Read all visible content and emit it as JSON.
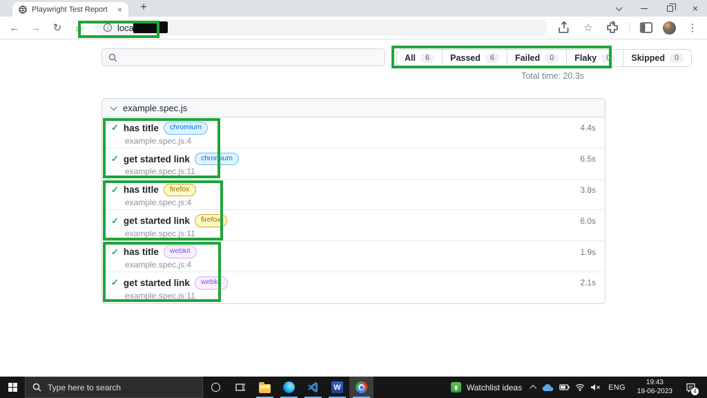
{
  "browser": {
    "tab_title": "Playwright Test Report",
    "tab_close": "×",
    "new_tab": "+",
    "url_text": "localhost:",
    "back": "←",
    "forward": "→",
    "reload": "↻",
    "home": "⌂",
    "bookmark_star": "☆",
    "menu_kebab": "⋮",
    "window_controls": [
      "tab-search-chevron",
      "minimize",
      "restore",
      "close"
    ],
    "toolbar_icons": [
      "back",
      "forward",
      "reload",
      "home",
      "site-info",
      "share",
      "bookmark-star",
      "extensions",
      "side-panel",
      "profile-avatar",
      "menu-kebab"
    ]
  },
  "report": {
    "search": {
      "value": "",
      "placeholder": ""
    },
    "filters": [
      {
        "label": "All",
        "count": "6"
      },
      {
        "label": "Passed",
        "count": "6"
      },
      {
        "label": "Failed",
        "count": "0"
      },
      {
        "label": "Flaky",
        "count": "0"
      },
      {
        "label": "Skipped",
        "count": "0"
      }
    ],
    "total_time": "Total time: 20.3s",
    "file_group": {
      "name": "example.spec.js",
      "tests": [
        {
          "title": "has title",
          "browser": "chromium",
          "location": "example.spec.js:4",
          "duration": "4.4s"
        },
        {
          "title": "get started link",
          "browser": "chromium",
          "location": "example.spec.js:11",
          "duration": "6.5s"
        },
        {
          "title": "has title",
          "browser": "firefox",
          "location": "example.spec.js:4",
          "duration": "3.8s"
        },
        {
          "title": "get started link",
          "browser": "firefox",
          "location": "example.spec.js:11",
          "duration": "6.0s"
        },
        {
          "title": "has title",
          "browser": "webkit",
          "location": "example.spec.js:4",
          "duration": "1.9s"
        },
        {
          "title": "get started link",
          "browser": "webkit",
          "location": "example.spec.js:11",
          "duration": "2.1s"
        }
      ]
    },
    "check_glyph": "✓",
    "badge_colors": {
      "chromium": {
        "bg": "#ddf4ff",
        "border": "#6cb6ff",
        "text": "#0969da"
      },
      "firefox": {
        "bg": "#fff8c5",
        "border": "#d4a72c",
        "text": "#9a6700"
      },
      "webkit": {
        "bg": "#fbefff",
        "border": "#d2a8ff",
        "text": "#8250df"
      }
    }
  },
  "annotations": {
    "color": "#1ea53b",
    "regions": [
      "url-bar",
      "filter-tabs",
      "chromium-tests",
      "firefox-tests",
      "webkit-tests"
    ]
  },
  "taskbar": {
    "search_placeholder": "Type here to search",
    "pinned_label": "Watchlist ideas",
    "language": "ENG",
    "time": "19:43",
    "date": "19-06-2023",
    "notification_count": "4",
    "app_icons": [
      "start",
      "cortana",
      "task-view",
      "file-explorer",
      "edge",
      "vscode",
      "word",
      "chrome"
    ],
    "tray_icons": [
      "hidden-icons-chevron",
      "onedrive-cloud",
      "battery",
      "wifi",
      "volume-muted",
      "notification-center"
    ],
    "word_glyph": "W"
  },
  "colors": {
    "annotation_green": "#1ea53b",
    "pass_check": "#2da44e",
    "chrome_frame": "#dee1e6",
    "taskbar_bg": "#161616",
    "card_border": "#d0d7de"
  }
}
